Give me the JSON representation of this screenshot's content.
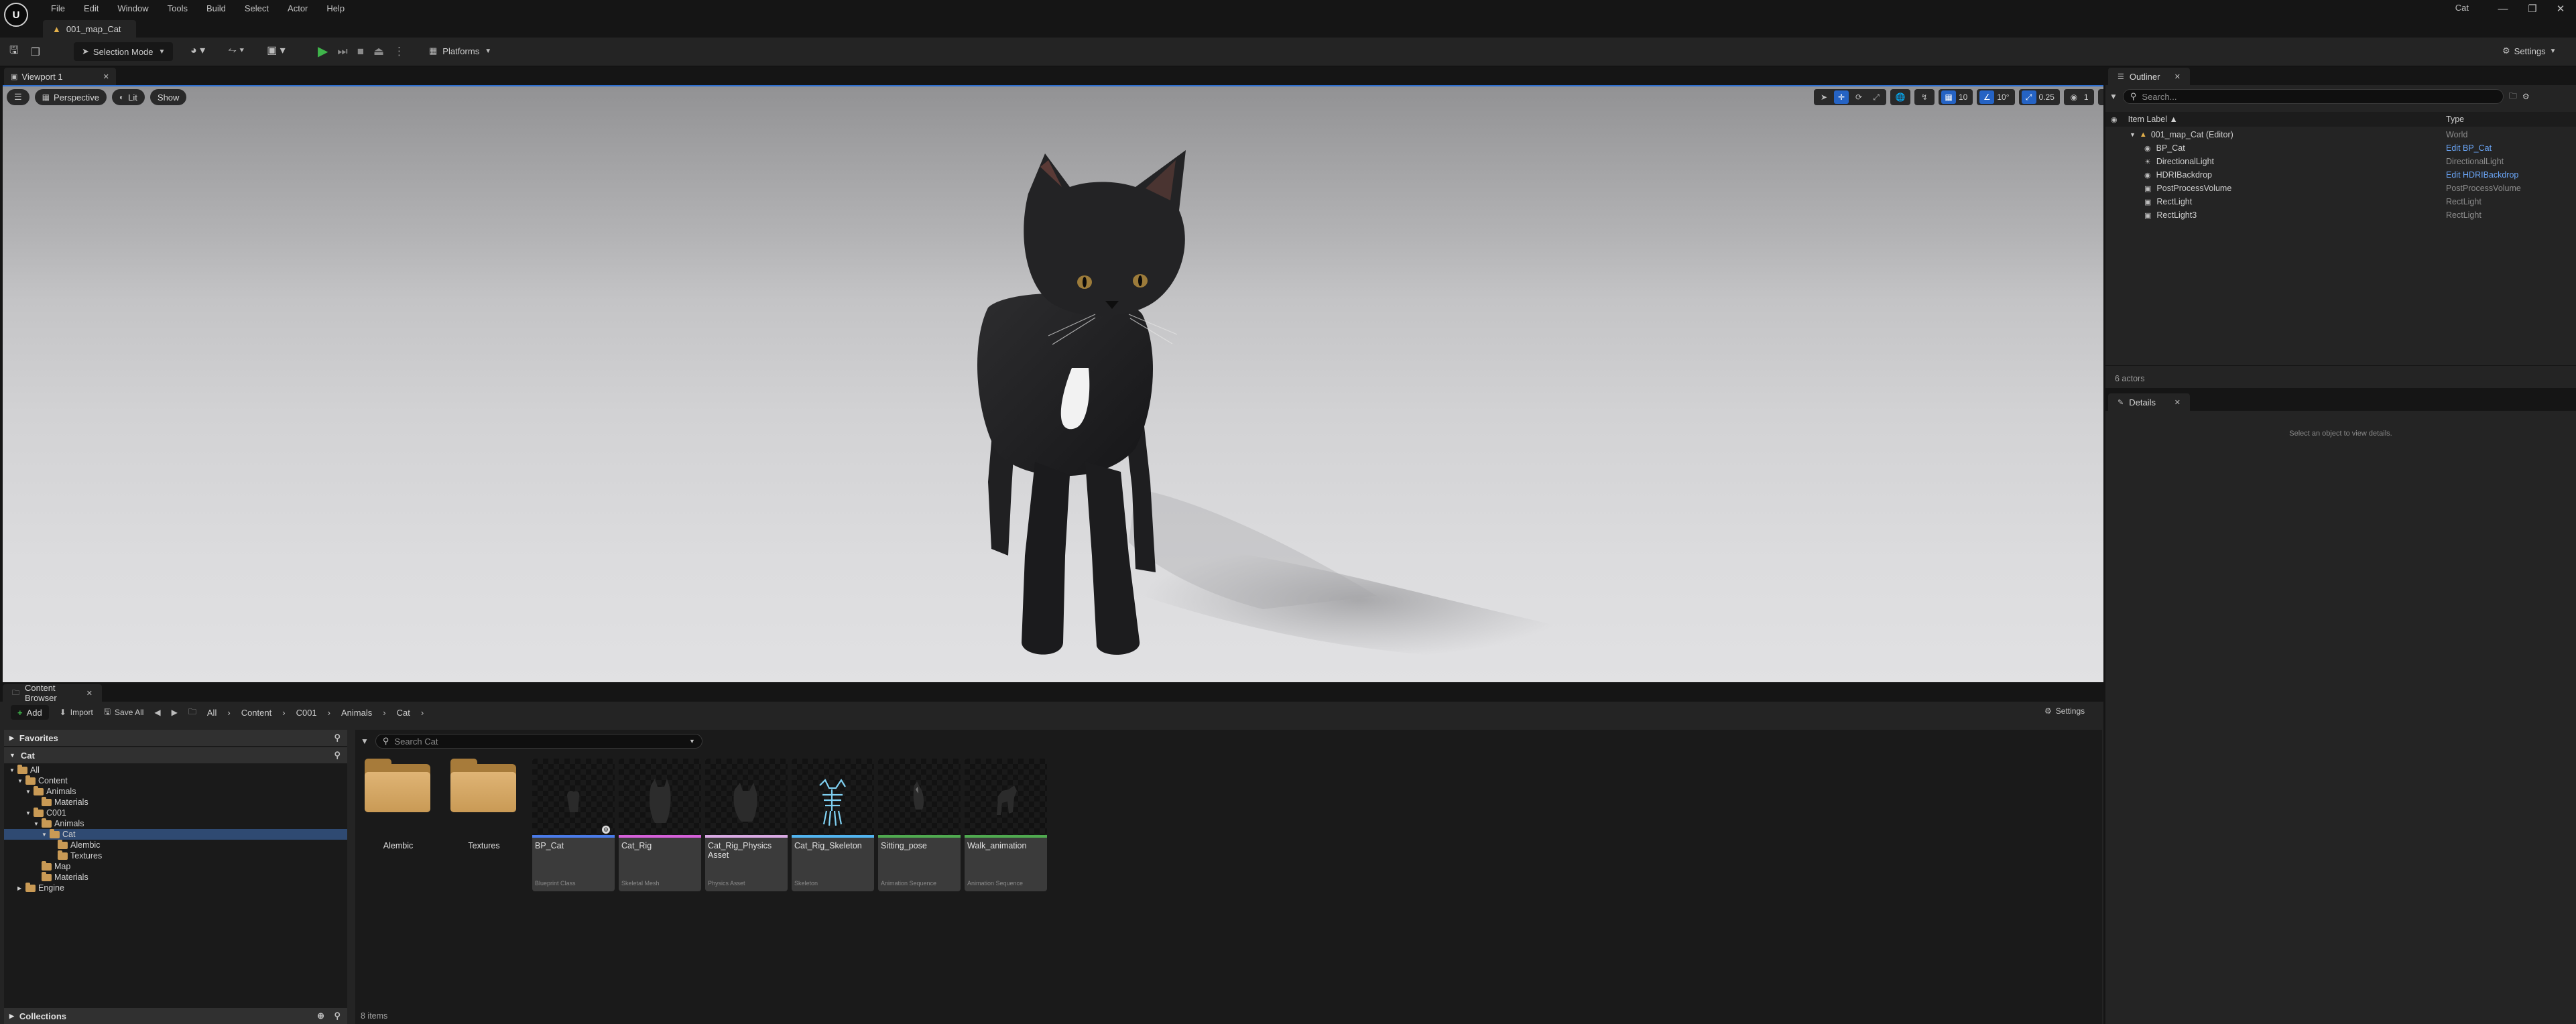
{
  "menu": {
    "items": [
      "File",
      "Edit",
      "Window",
      "Tools",
      "Build",
      "Select",
      "Actor",
      "Help"
    ]
  },
  "window": {
    "project_name": "Cat",
    "logo_letter": "U"
  },
  "level_tab": {
    "label": "001_map_Cat"
  },
  "toolbar": {
    "selection_mode": "Selection Mode",
    "platforms": "Platforms",
    "settings": "Settings"
  },
  "viewport": {
    "tab_label": "Viewport 1",
    "perspective": "Perspective",
    "lit": "Lit",
    "show": "Show",
    "grid_snap": "10",
    "rotation_snap": "10°",
    "scale_snap": "0.25",
    "camera_speed": "1"
  },
  "outliner": {
    "tab_label": "Outliner",
    "search_placeholder": "Search...",
    "col_label": "Item Label ▲",
    "col_type": "Type",
    "rows": [
      {
        "label": "001_map_Cat (Editor)",
        "type": "World"
      },
      {
        "label": "BP_Cat",
        "type": "Edit BP_Cat"
      },
      {
        "label": "DirectionalLight",
        "type": "DirectionalLight"
      },
      {
        "label": "HDRIBackdrop",
        "type": "Edit HDRIBackdrop"
      },
      {
        "label": "PostProcessVolume",
        "type": "PostProcessVolume"
      },
      {
        "label": "RectLight",
        "type": "RectLight"
      },
      {
        "label": "RectLight3",
        "type": "RectLight"
      }
    ],
    "actor_count": "6 actors"
  },
  "details": {
    "tab_label": "Details",
    "empty_message": "Select an object to view details."
  },
  "content_browser": {
    "tab_label": "Content Browser",
    "add": "Add",
    "import": "Import",
    "save_all": "Save All",
    "breadcrumb": [
      "All",
      "Content",
      "C001",
      "Animals",
      "Cat"
    ],
    "settings": "Settings",
    "favorites": "Favorites",
    "tree_root": "Cat",
    "tree": [
      {
        "label": "All"
      },
      {
        "label": "Content"
      },
      {
        "label": "Animals"
      },
      {
        "label": "Materials"
      },
      {
        "label": "C001"
      },
      {
        "label": "Animals"
      },
      {
        "label": "Cat"
      },
      {
        "label": "Alembic"
      },
      {
        "label": "Textures"
      },
      {
        "label": "Map"
      },
      {
        "label": "Materials"
      },
      {
        "label": "Engine"
      }
    ],
    "collections": "Collections",
    "search_placeholder": "Search Cat",
    "folders": [
      "Alembic",
      "Textures"
    ],
    "assets": [
      {
        "name": "BP_Cat",
        "type": "Blueprint Class",
        "color": "#4a7be8"
      },
      {
        "name": "Cat_Rig",
        "type": "Skeletal Mesh",
        "color": "#d460d8"
      },
      {
        "name": "Cat_Rig_Physics Asset",
        "type": "Physics Asset",
        "color": "#d8a9e2"
      },
      {
        "name": "Cat_Rig_Skeleton",
        "type": "Skeleton",
        "color": "#52b4ef"
      },
      {
        "name": "Sitting_pose",
        "type": "Animation Sequence",
        "color": "#4fa94f"
      },
      {
        "name": "Walk_animation",
        "type": "Animation Sequence",
        "color": "#4fa94f"
      }
    ],
    "item_count": "8 items"
  }
}
